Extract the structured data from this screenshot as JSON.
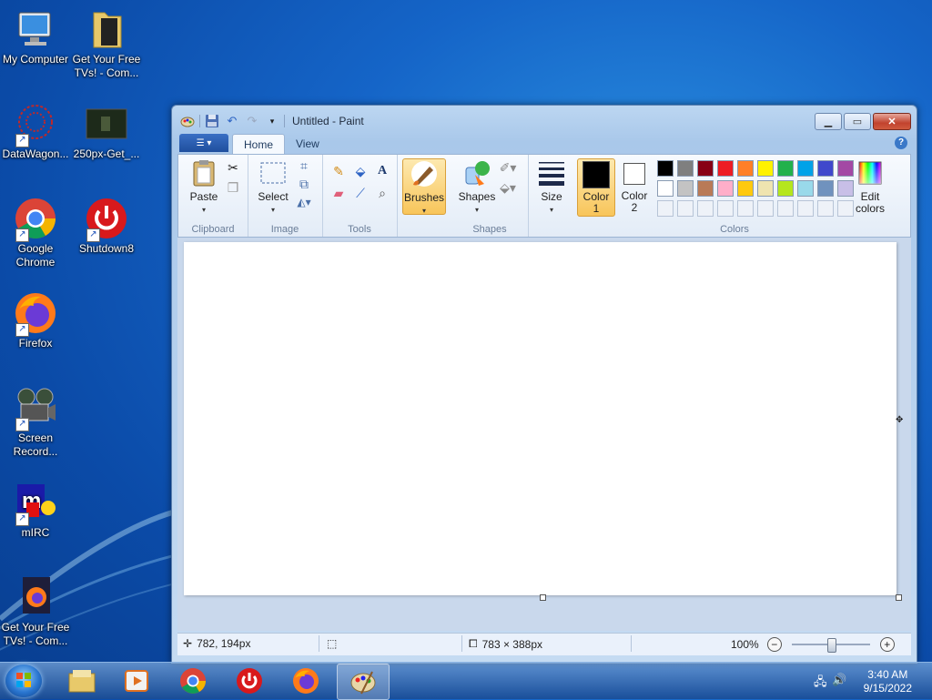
{
  "desktop": {
    "icons": [
      {
        "label": "My Computer"
      },
      {
        "label": "Get Your Free TVs! - Com..."
      },
      {
        "label": "DataWagon..."
      },
      {
        "label": "250px-Get_..."
      },
      {
        "label": "Google Chrome"
      },
      {
        "label": "Shutdown8"
      },
      {
        "label": "Firefox"
      },
      {
        "label": "Screen Record..."
      },
      {
        "label": "mIRC"
      },
      {
        "label": "Get Your Free TVs! - Com..."
      }
    ]
  },
  "window": {
    "title": "Untitled - Paint",
    "tabs": [
      {
        "label": "Home"
      },
      {
        "label": "View"
      }
    ],
    "ribbon": {
      "clipboard": {
        "label": "Clipboard",
        "paste": "Paste"
      },
      "image": {
        "label": "Image",
        "select": "Select"
      },
      "tools": {
        "label": "Tools"
      },
      "brushes": "Brushes",
      "shapes": {
        "label": "Shapes",
        "button": "Shapes"
      },
      "size": "Size",
      "color1": "Color 1",
      "color2": "Color 2",
      "colors": {
        "label": "Colors",
        "edit": "Edit colors"
      }
    },
    "palette_row1": [
      "#000000",
      "#7f7f7f",
      "#880015",
      "#ed1c24",
      "#ff7f27",
      "#fff200",
      "#22b14c",
      "#00a2e8",
      "#3f48cc",
      "#a349a4"
    ],
    "palette_row2": [
      "#ffffff",
      "#c3c3c3",
      "#b97a57",
      "#ffaec9",
      "#ffc90e",
      "#efe4b0",
      "#b5e61d",
      "#99d9ea",
      "#7092be",
      "#c8bfe7"
    ],
    "color1_value": "#000000",
    "color2_value": "#ffffff",
    "statusbar": {
      "cursor_pos": "782, 194px",
      "canvas_size": "783 × 388px",
      "zoom": "100%",
      "zoom_level": 0.5
    }
  },
  "taskbar": {
    "time": "3:40 AM",
    "date": "9/15/2022"
  }
}
